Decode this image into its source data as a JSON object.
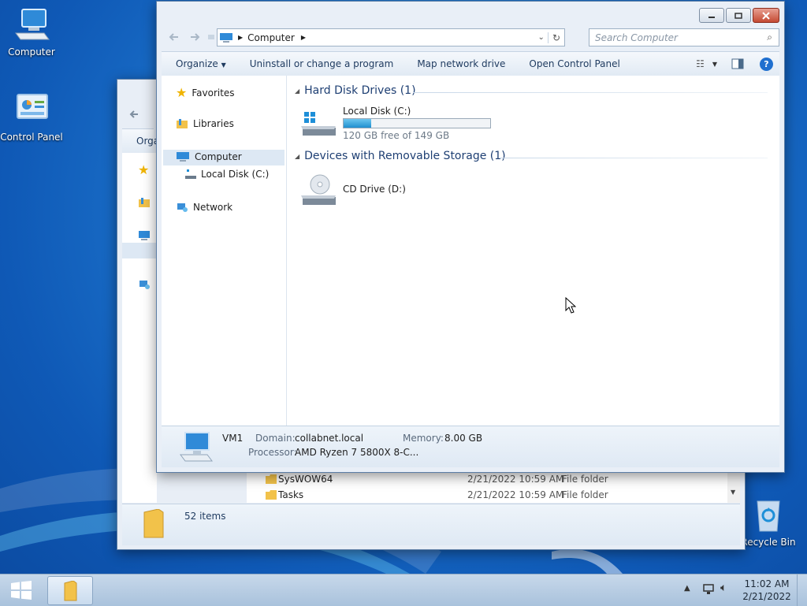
{
  "desktop": {
    "icons": [
      {
        "label": "Computer"
      },
      {
        "label": "Control Panel"
      },
      {
        "label": "Recycle Bin"
      }
    ]
  },
  "back_window": {
    "toolbar_partial": "Orga",
    "rows": [
      {
        "name": "SysWOW64",
        "date": "2/21/2022 10:59 AM",
        "type": "File folder"
      },
      {
        "name": "Tasks",
        "date": "2/21/2022 10:59 AM",
        "type": "File folder"
      }
    ],
    "status": "52 items"
  },
  "front_window": {
    "address": {
      "crumb": "Computer"
    },
    "search": {
      "placeholder": "Search Computer"
    },
    "toolbar": {
      "organize": "Organize",
      "uninstall": "Uninstall or change a program",
      "map_drive": "Map network drive",
      "control_panel": "Open Control Panel"
    },
    "nav": {
      "favorites": "Favorites",
      "libraries": "Libraries",
      "computer": "Computer",
      "local_disk": "Local Disk (C:)",
      "network": "Network"
    },
    "groups": {
      "hdd": "Hard Disk Drives (1)",
      "removable": "Devices with Removable Storage (1)"
    },
    "drives": {
      "c_name": "Local Disk (C:)",
      "c_free": "120 GB free of 149 GB",
      "c_used_fraction": 0.19,
      "d_name": "CD Drive (D:)"
    },
    "details": {
      "name": "VM1",
      "domain_label": "Domain:",
      "domain": "collabnet.local",
      "memory_label": "Memory:",
      "memory": "8.00 GB",
      "processor_label": "Processor:",
      "processor": "AMD Ryzen 7 5800X 8-C..."
    }
  },
  "taskbar": {
    "time": "11:02 AM",
    "date": "2/21/2022"
  },
  "colors": {
    "desktop": "#1f78d0",
    "accent": "#1e3f73"
  }
}
